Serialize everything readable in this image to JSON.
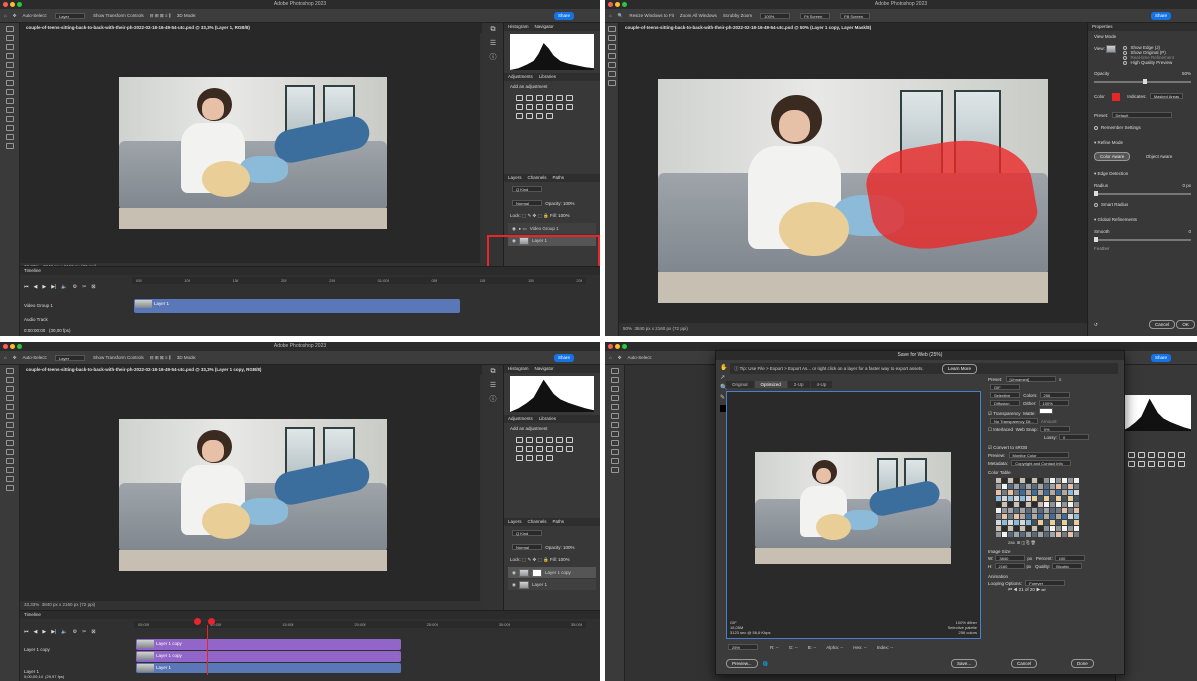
{
  "app": {
    "title": "Adobe Photoshop 2023",
    "share_label": "Share"
  },
  "options": {
    "auto_select": "Auto-Select:",
    "layer_value": "Layer",
    "show_transform": "Show Transform Controls",
    "mode_3d": "3D Mode:"
  },
  "q1": {
    "tab": "couple-of-teens-sitting-back-to-back-with-their-ph-2022-02-18-16-49-54-utc.psd @ 33,3% (Layer 1, RGB/8)",
    "zoom": "33,33%",
    "doc_size": "3840 px x 2160 px (72 ppi)",
    "panel_tabs": [
      "Histogram",
      "Navigator"
    ],
    "adj_tabs": [
      "Adjustments",
      "Libraries"
    ],
    "adj_hint": "Add an adjustment",
    "layers_tabs": [
      "Layers",
      "Channels",
      "Paths"
    ],
    "kind": "Q Kind",
    "blend": "Normal",
    "opacity": "Opacity: 100%",
    "fill": "Fill: 100%",
    "lock": "Lock:",
    "layers": [
      "Video Group 1",
      "Layer 1"
    ],
    "timeline_label": "Timeline",
    "tracks": [
      "Video Group 1",
      "Audio Track"
    ],
    "clip": "Layer 1",
    "timecode": "0:00:00:00",
    "fps": "(30,00 fps)",
    "ruler": [
      "05f",
      "10f",
      "15f",
      "20f",
      "25f",
      "01:00f",
      "05f",
      "10f",
      "15f",
      "20f"
    ]
  },
  "q2": {
    "options": [
      "Resize Windows to Fit",
      "Zoom All Windows",
      "Scrubby Zoom",
      "100%",
      "Fit Screen",
      "Fill Screen"
    ],
    "tab": "couple-of-teens-sitting-back-to-back-with-their-ph-2022-02-18-16-49-54-utc.psd @ 50% (Layer 1 copy, Layer Mask/8)",
    "zoom": "50%",
    "doc_size": "3840 px x 2160 px (72 ppi)",
    "props_title": "Properties",
    "view_mode": "View Mode",
    "view_label": "View:",
    "show_edge": "Show Edge (J)",
    "show_original": "Show Original (P)",
    "realtime": "Real-time Refinement",
    "hq_preview": "High Quality Preview",
    "opacity": "Opacity",
    "opacity_val": "50%",
    "color_label": "Color",
    "indicates": "Indicates:",
    "masked_areas": "Masked Areas",
    "preset_label": "Preset:",
    "preset_val": "Default",
    "remember": "Remember Settings",
    "refine_mode": "Refine Mode",
    "color_aware": "Color Aware",
    "object_aware": "Object Aware",
    "edge_detection": "Edge Detection",
    "radius": "Radius",
    "radius_val": "0 px",
    "smart_radius": "Smart Radius",
    "global_ref": "Global Refinements",
    "smooth": "Smooth",
    "smooth_val": "0",
    "feather": "Feather",
    "cancel": "Cancel",
    "ok": "OK",
    "mask_color": "#e8262a"
  },
  "q3": {
    "tab": "couple-of-teens-sitting-back-to-back-with-their-ph-2022-02-18-16-49-54-utc.psd @ 33,3% (Layer 1 copy, RGB/8)",
    "zoom": "33,33%",
    "doc_size": "3840 px x 2160 px (72 ppi)",
    "layers": [
      "Layer 1 copy",
      "Layer 1"
    ],
    "tracks": [
      "Layer 1 copy",
      "Layer 1"
    ],
    "clips": [
      "Layer 1 copy",
      "Layer 1 copy",
      "Layer 1"
    ],
    "timecode": "0;00;00;14",
    "fps": "(29,97 fps)",
    "ruler": [
      "05:00f",
      "10:00f",
      "15:00f",
      "20:00f",
      "25:00f",
      "30:00f",
      "35:00f"
    ]
  },
  "q4": {
    "dialog_title": "Save for Web (25%)",
    "tip": "Tip: Use File > Export > Export As... or right click on a layer for a faster way to export assets.",
    "learn_more": "Learn More",
    "tabs": [
      "Original",
      "Optimized",
      "2-Up",
      "4-Up"
    ],
    "preset_label": "Preset:",
    "preset_val": "[Unnamed]",
    "format": "GIF",
    "reduction": "Selective",
    "dither_algo": "Diffusion",
    "colors_label": "Colors:",
    "colors_val": "256",
    "dither_label": "Dither:",
    "dither_val": "100%",
    "transparency": "Transparency",
    "matte": "Matte:",
    "no_trans_dither": "No Transparency Dit...",
    "amount": "Amount:",
    "interlaced": "Interlaced",
    "web_snap": "Web Snap:",
    "web_snap_val": "0%",
    "lossy": "Lossy:",
    "lossy_val": "0",
    "convert_srgb": "Convert to sRGB",
    "preview_label": "Preview:",
    "preview_val": "Monitor Color",
    "metadata_label": "Metadata:",
    "metadata_val": "Copyright and Contact Info",
    "color_table": "Color Table",
    "color_count": "256",
    "image_size": "Image Size",
    "w_label": "W:",
    "w_val": "3840",
    "h_label": "H:",
    "h_val": "2160",
    "px": "px",
    "percent_label": "Percent:",
    "percent_val": "100",
    "quality_label": "Quality:",
    "quality_val": "Bicubic",
    "animation": "Animation",
    "looping": "Looping Options:",
    "looping_val": "Forever",
    "frame": "21 of 20",
    "info_left": [
      "GIF",
      "16,05M",
      "3123 sec @ 56,6 Kbps"
    ],
    "info_right": [
      "100% dither",
      "Selective palette",
      "256 colors"
    ],
    "zoom": "25%",
    "r_label": "R: --",
    "g_label": "G: --",
    "b_label": "B: --",
    "alpha": "Alpha: --",
    "hex": "Hex: --",
    "index": "Index: --",
    "preview_btn": "Preview...",
    "save": "Save...",
    "cancel": "Cancel",
    "done": "Done",
    "accent": "#1473e6"
  }
}
